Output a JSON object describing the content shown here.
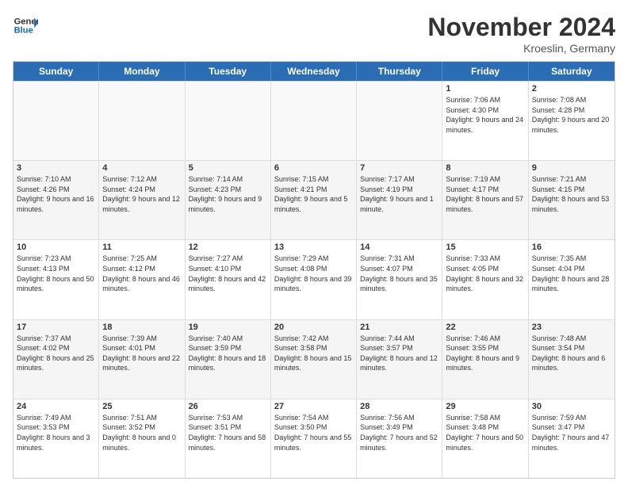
{
  "logo": {
    "line1": "General",
    "line2": "Blue"
  },
  "title": "November 2024",
  "location": "Kroeslin, Germany",
  "days_of_week": [
    "Sunday",
    "Monday",
    "Tuesday",
    "Wednesday",
    "Thursday",
    "Friday",
    "Saturday"
  ],
  "weeks": [
    [
      {
        "day": "",
        "info": "",
        "empty": true
      },
      {
        "day": "",
        "info": "",
        "empty": true
      },
      {
        "day": "",
        "info": "",
        "empty": true
      },
      {
        "day": "",
        "info": "",
        "empty": true
      },
      {
        "day": "",
        "info": "",
        "empty": true
      },
      {
        "day": "1",
        "info": "Sunrise: 7:06 AM\nSunset: 4:30 PM\nDaylight: 9 hours and 24 minutes."
      },
      {
        "day": "2",
        "info": "Sunrise: 7:08 AM\nSunset: 4:28 PM\nDaylight: 9 hours and 20 minutes."
      }
    ],
    [
      {
        "day": "3",
        "info": "Sunrise: 7:10 AM\nSunset: 4:26 PM\nDaylight: 9 hours and 16 minutes."
      },
      {
        "day": "4",
        "info": "Sunrise: 7:12 AM\nSunset: 4:24 PM\nDaylight: 9 hours and 12 minutes."
      },
      {
        "day": "5",
        "info": "Sunrise: 7:14 AM\nSunset: 4:23 PM\nDaylight: 9 hours and 9 minutes."
      },
      {
        "day": "6",
        "info": "Sunrise: 7:15 AM\nSunset: 4:21 PM\nDaylight: 9 hours and 5 minutes."
      },
      {
        "day": "7",
        "info": "Sunrise: 7:17 AM\nSunset: 4:19 PM\nDaylight: 9 hours and 1 minute."
      },
      {
        "day": "8",
        "info": "Sunrise: 7:19 AM\nSunset: 4:17 PM\nDaylight: 8 hours and 57 minutes."
      },
      {
        "day": "9",
        "info": "Sunrise: 7:21 AM\nSunset: 4:15 PM\nDaylight: 8 hours and 53 minutes."
      }
    ],
    [
      {
        "day": "10",
        "info": "Sunrise: 7:23 AM\nSunset: 4:13 PM\nDaylight: 8 hours and 50 minutes."
      },
      {
        "day": "11",
        "info": "Sunrise: 7:25 AM\nSunset: 4:12 PM\nDaylight: 8 hours and 46 minutes."
      },
      {
        "day": "12",
        "info": "Sunrise: 7:27 AM\nSunset: 4:10 PM\nDaylight: 8 hours and 42 minutes."
      },
      {
        "day": "13",
        "info": "Sunrise: 7:29 AM\nSunset: 4:08 PM\nDaylight: 8 hours and 39 minutes."
      },
      {
        "day": "14",
        "info": "Sunrise: 7:31 AM\nSunset: 4:07 PM\nDaylight: 8 hours and 35 minutes."
      },
      {
        "day": "15",
        "info": "Sunrise: 7:33 AM\nSunset: 4:05 PM\nDaylight: 8 hours and 32 minutes."
      },
      {
        "day": "16",
        "info": "Sunrise: 7:35 AM\nSunset: 4:04 PM\nDaylight: 8 hours and 28 minutes."
      }
    ],
    [
      {
        "day": "17",
        "info": "Sunrise: 7:37 AM\nSunset: 4:02 PM\nDaylight: 8 hours and 25 minutes."
      },
      {
        "day": "18",
        "info": "Sunrise: 7:39 AM\nSunset: 4:01 PM\nDaylight: 8 hours and 22 minutes."
      },
      {
        "day": "19",
        "info": "Sunrise: 7:40 AM\nSunset: 3:59 PM\nDaylight: 8 hours and 18 minutes."
      },
      {
        "day": "20",
        "info": "Sunrise: 7:42 AM\nSunset: 3:58 PM\nDaylight: 8 hours and 15 minutes."
      },
      {
        "day": "21",
        "info": "Sunrise: 7:44 AM\nSunset: 3:57 PM\nDaylight: 8 hours and 12 minutes."
      },
      {
        "day": "22",
        "info": "Sunrise: 7:46 AM\nSunset: 3:55 PM\nDaylight: 8 hours and 9 minutes."
      },
      {
        "day": "23",
        "info": "Sunrise: 7:48 AM\nSunset: 3:54 PM\nDaylight: 8 hours and 6 minutes."
      }
    ],
    [
      {
        "day": "24",
        "info": "Sunrise: 7:49 AM\nSunset: 3:53 PM\nDaylight: 8 hours and 3 minutes."
      },
      {
        "day": "25",
        "info": "Sunrise: 7:51 AM\nSunset: 3:52 PM\nDaylight: 8 hours and 0 minutes."
      },
      {
        "day": "26",
        "info": "Sunrise: 7:53 AM\nSunset: 3:51 PM\nDaylight: 7 hours and 58 minutes."
      },
      {
        "day": "27",
        "info": "Sunrise: 7:54 AM\nSunset: 3:50 PM\nDaylight: 7 hours and 55 minutes."
      },
      {
        "day": "28",
        "info": "Sunrise: 7:56 AM\nSunset: 3:49 PM\nDaylight: 7 hours and 52 minutes."
      },
      {
        "day": "29",
        "info": "Sunrise: 7:58 AM\nSunset: 3:48 PM\nDaylight: 7 hours and 50 minutes."
      },
      {
        "day": "30",
        "info": "Sunrise: 7:59 AM\nSunset: 3:47 PM\nDaylight: 7 hours and 47 minutes."
      }
    ]
  ]
}
